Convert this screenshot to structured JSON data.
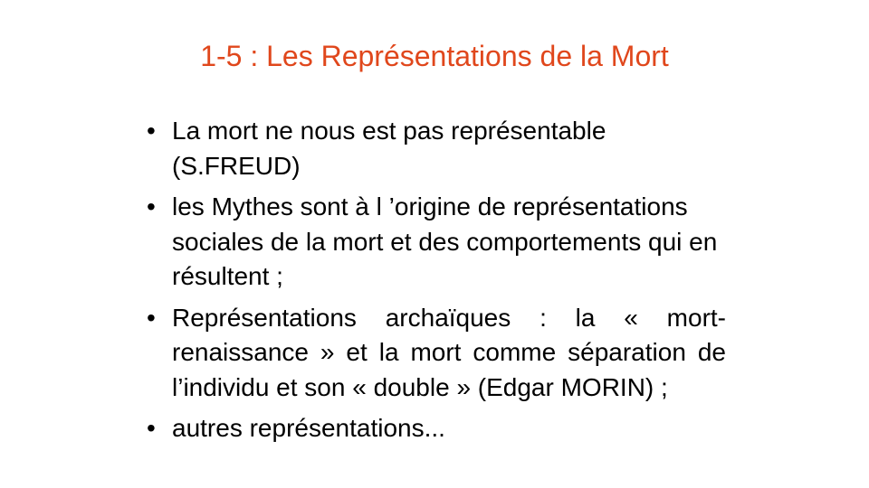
{
  "slide": {
    "title": "1-5 : Les Représentations de la Mort",
    "bullet_symbol": "•",
    "bullets": [
      {
        "text": "La mort ne nous est pas représentable (S.FREUD)"
      },
      {
        "text": "les Mythes sont à l ’origine de représentations sociales de la mort et des comportements qui en résultent ;"
      },
      {
        "text": "Représentations archaïques : la « mort-renaissance » et la mort comme séparation de l’individu et son « double » (Edgar MORIN) ;"
      },
      {
        "text": "autres représentations..."
      }
    ]
  },
  "colors": {
    "title": "#e0471c",
    "body_text": "#000000",
    "background": "#ffffff"
  }
}
